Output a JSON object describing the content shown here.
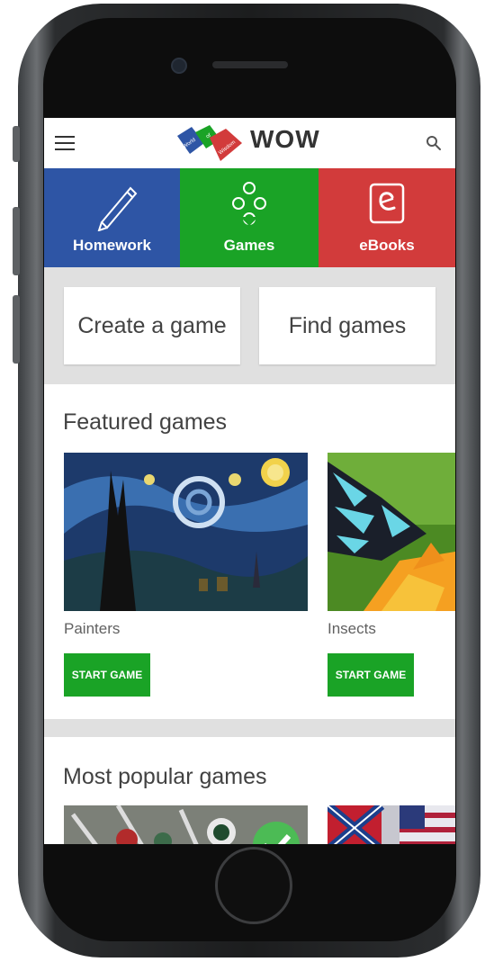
{
  "app": {
    "logo_text": "WOW",
    "logo_tile_words": [
      "World",
      "of",
      "Wisdom"
    ]
  },
  "tabs": [
    {
      "label": "Homework",
      "color": "#2e55a5",
      "icon": "pencil-icon"
    },
    {
      "label": "Games",
      "color": "#1aa326",
      "icon": "circles-icon",
      "selected": true
    },
    {
      "label": "eBooks",
      "color": "#d23b3b",
      "icon": "ebook-icon"
    }
  ],
  "actions": {
    "create": "Create a game",
    "find": "Find games"
  },
  "featured": {
    "title": "Featured games",
    "games": [
      {
        "name": "Painters",
        "button": "START GAME",
        "image": "starry-night-painting"
      },
      {
        "name": "Insects",
        "button": "START GAME",
        "image": "butterfly-on-flower"
      }
    ]
  },
  "popular": {
    "title": "Most popular games",
    "games": [
      {
        "image": "football-players",
        "completed": true
      },
      {
        "image": "flags"
      }
    ]
  },
  "colors": {
    "accent_green": "#1aa326",
    "blue": "#2e55a5",
    "red": "#d23b3b"
  }
}
